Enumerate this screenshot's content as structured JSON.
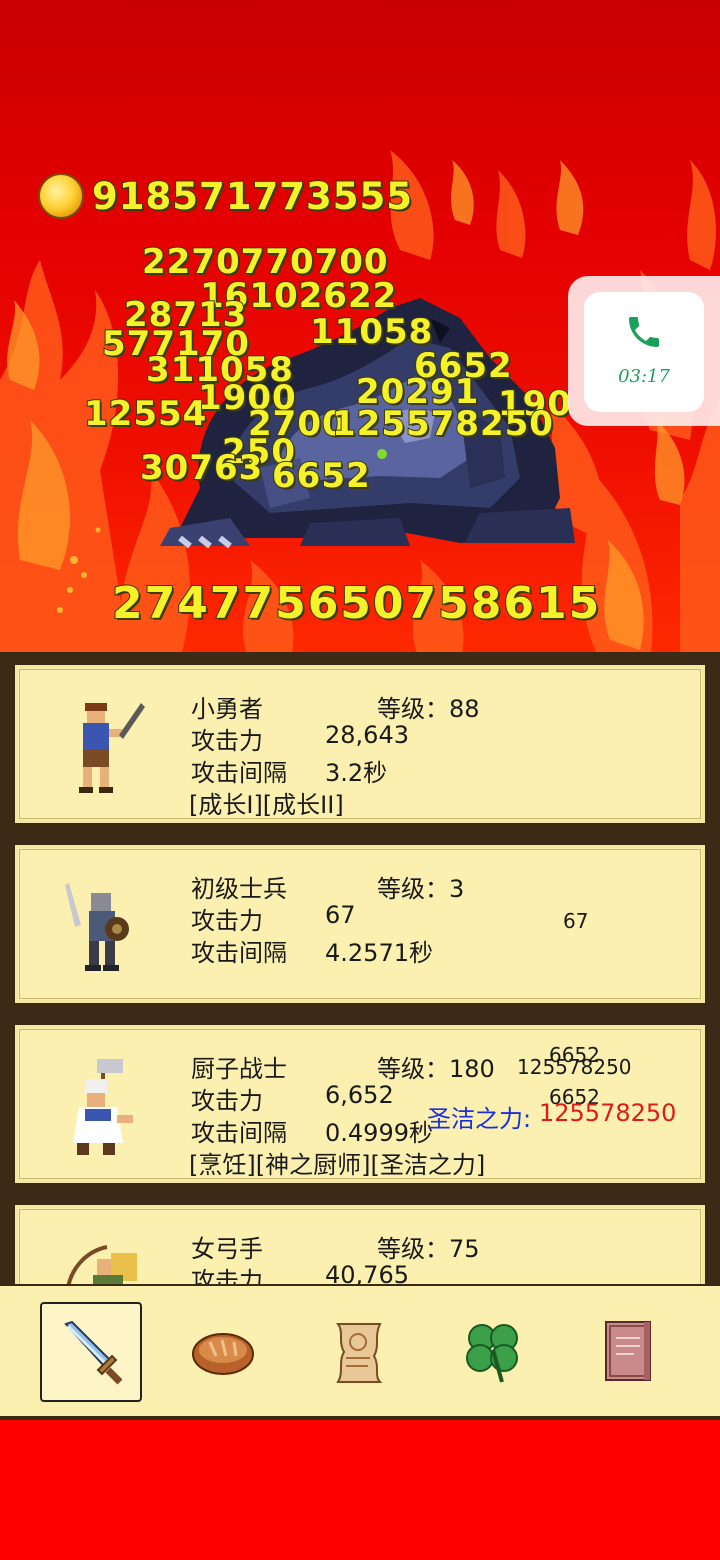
{
  "gold": {
    "icon": "gold-coin-icon",
    "amount": "918571773555"
  },
  "battle": {
    "monster": "dark-beast-monster",
    "total_damage": "274775650758615",
    "damage_popups": [
      "2270770700",
      "16102622",
      "28713",
      "11058",
      "577170",
      "311058",
      "6652",
      "20291",
      "190",
      "12554",
      "2700",
      "125578250",
      "250",
      "30763",
      "6652",
      "1900",
      "250"
    ]
  },
  "call_widget": {
    "icon": "phone-icon",
    "time": "03:17"
  },
  "heroes": [
    {
      "name": "小勇者",
      "level_label": "等级：88",
      "attack_label": "攻击力",
      "attack": "28,643",
      "interval_label": "攻击间隔",
      "interval": "3.2秒",
      "skills": "[成长I][成长II]",
      "sprite": "swordsman-hero-icon"
    },
    {
      "name": "初级士兵",
      "level_label": "等级：3",
      "attack_label": "攻击力",
      "attack": "67",
      "interval_label": "攻击间隔",
      "interval": "4.2571秒",
      "skills": "",
      "sprite": "soldier-hero-icon",
      "popup": "67"
    },
    {
      "name": "厨子战士",
      "level_label": "等级：180",
      "attack_label": "攻击力",
      "attack": "6,652",
      "interval_label": "攻击间隔",
      "interval": "0.4999秒",
      "skills": "[烹饪][神之厨师][圣洁之力]",
      "sprite": "chef-hero-icon",
      "popup_a": "6652",
      "popup_b": "125578250",
      "popup_c": "6652",
      "holy_label": "圣洁之力:",
      "holy_value": "125578250"
    },
    {
      "name": "女弓手",
      "level_label": "等级：75",
      "attack_label": "攻击力",
      "attack": "40,765",
      "sprite": "archer-hero-icon"
    }
  ],
  "nav": [
    {
      "icon": "sword-icon",
      "active": true
    },
    {
      "icon": "bread-icon",
      "active": false
    },
    {
      "icon": "scroll-icon",
      "active": false
    },
    {
      "icon": "clover-icon",
      "active": false
    },
    {
      "icon": "book-icon",
      "active": false
    }
  ],
  "colors": {
    "damage_text": "#f6f22a",
    "card_bg": "#fbf0b0",
    "holy_label": "#1a2fe0",
    "holy_value": "#e01a1a"
  }
}
